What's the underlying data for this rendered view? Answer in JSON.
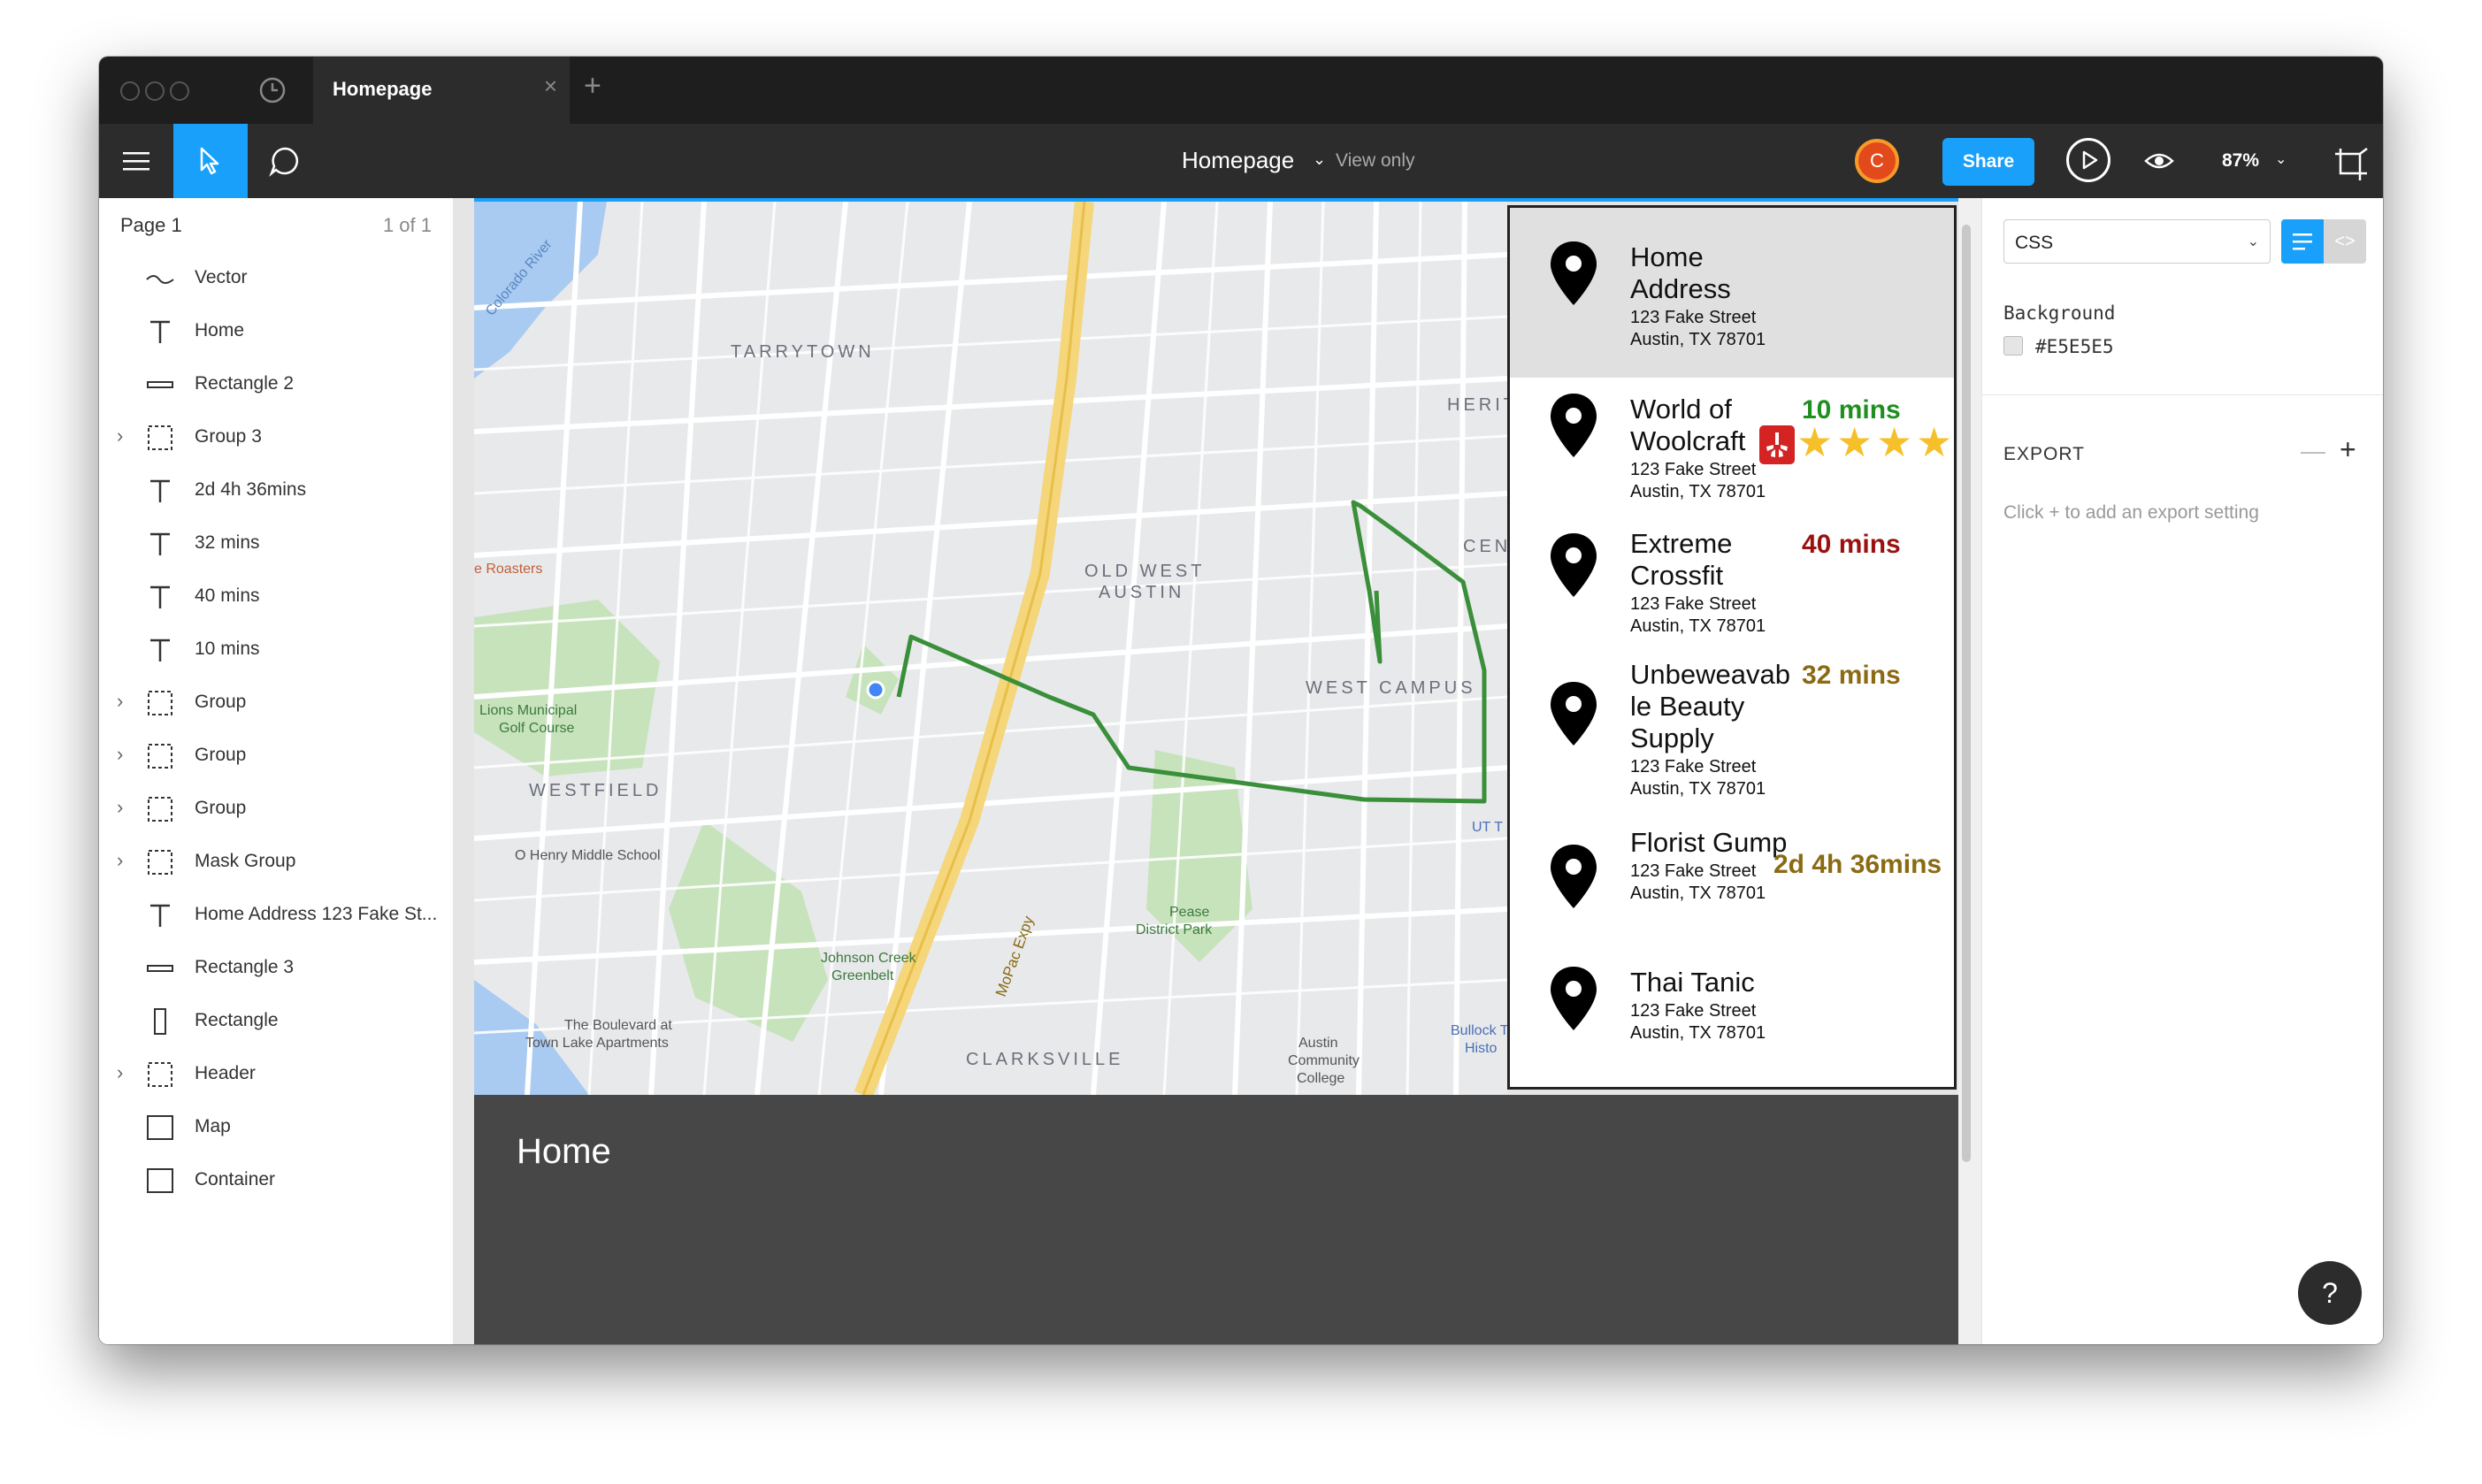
{
  "titlebar": {
    "tab_label": "Homepage",
    "tab_close": "×",
    "tab_add": "+"
  },
  "toolbar": {
    "doc_title": "Homepage",
    "doc_chevron": "⌄",
    "view_only": "View only",
    "avatar_initial": "C",
    "share_label": "Share",
    "zoom": "87%",
    "zoom_chevron": "⌄",
    "icons": [
      "menu-icon",
      "move-tool-icon",
      "comment-icon",
      "play-icon",
      "eye-icon",
      "crop-icon"
    ]
  },
  "left_panel": {
    "page_label": "Page 1",
    "page_count": "1 of 1",
    "layers": [
      {
        "label": "Vector",
        "icon": "vector",
        "caret": false
      },
      {
        "label": "Home",
        "icon": "text",
        "caret": false
      },
      {
        "label": "Rectangle 2",
        "icon": "rect-line",
        "caret": false
      },
      {
        "label": "Group 3",
        "icon": "group",
        "caret": true
      },
      {
        "label": "2d 4h 36mins",
        "icon": "text",
        "caret": false
      },
      {
        "label": "32 mins",
        "icon": "text",
        "caret": false
      },
      {
        "label": "40 mins",
        "icon": "text",
        "caret": false
      },
      {
        "label": "10 mins",
        "icon": "text",
        "caret": false
      },
      {
        "label": "Group",
        "icon": "group",
        "caret": true
      },
      {
        "label": "Group",
        "icon": "group",
        "caret": true
      },
      {
        "label": "Group",
        "icon": "group",
        "caret": true
      },
      {
        "label": "Mask Group",
        "icon": "group",
        "caret": true
      },
      {
        "label": "Home Address 123 Fake St...",
        "icon": "text",
        "caret": false
      },
      {
        "label": "Rectangle 3",
        "icon": "rect-line",
        "caret": false
      },
      {
        "label": "Rectangle",
        "icon": "rect-tall",
        "caret": false
      },
      {
        "label": "Header",
        "icon": "group",
        "caret": true
      },
      {
        "label": "Map",
        "icon": "frame",
        "caret": false
      },
      {
        "label": "Container",
        "icon": "frame",
        "caret": false
      }
    ]
  },
  "map": {
    "labels": [
      "TARRYTOWN",
      "OLD WEST",
      "AUSTIN",
      "WEST CAMPUS",
      "WESTFIELD",
      "CLARKSVILLE",
      "HERIT",
      "CEN",
      "Lions Municipal",
      "Golf Course",
      "O Henry Middle School",
      "Johnson Creek",
      "Greenbelt",
      "The Boulevard at",
      "Town Lake Apartments",
      "Pease",
      "District Park",
      "Austin",
      "Community",
      "College",
      "Bullock T",
      "Histo",
      "e Roasters",
      "Colorado River",
      "MoPac Expy",
      "UT T"
    ],
    "route_color": "#3a8f3a"
  },
  "list": {
    "items": [
      {
        "name_lines": [
          "Home",
          "Address"
        ],
        "street": "123 Fake Street",
        "city": "Austin, TX 78701",
        "time": "",
        "time_color": ""
      },
      {
        "name_lines": [
          "World of",
          "Woolcraft"
        ],
        "street": "123 Fake Street",
        "city": "Austin, TX 78701",
        "time": "10 mins",
        "time_color": "#1f8f1f",
        "rating_stars": 4,
        "badge": "yelp-icon"
      },
      {
        "name_lines": [
          "Extreme",
          "Crossfit"
        ],
        "street": "123 Fake Street",
        "city": "Austin, TX 78701",
        "time": "40 mins",
        "time_color": "#9b1111"
      },
      {
        "name_lines": [
          "Unbeweavab",
          "le Beauty",
          "Supply"
        ],
        "street": "123 Fake Street",
        "city": "Austin, TX 78701",
        "time": "32 mins",
        "time_color": "#8a6a12"
      },
      {
        "name_lines": [
          "Florist Gump"
        ],
        "street": "123 Fake Street",
        "city": "Austin, TX 78701",
        "time": "2d 4h 36mins",
        "time_color": "#8a6a12"
      },
      {
        "name_lines": [
          "Thai Tanic"
        ],
        "street": "123 Fake Street",
        "city": "Austin, TX 78701",
        "time": "",
        "time_color": ""
      }
    ]
  },
  "home_bar": {
    "title": "Home"
  },
  "right_panel": {
    "code_select": "CSS",
    "background_label": "Background",
    "background_value": "#E5E5E5",
    "export_label": "EXPORT",
    "export_minus": "—",
    "export_plus": "+",
    "export_hint": "Click + to add an export setting",
    "code_toggle": "<>"
  },
  "help": "?",
  "colors": {
    "accent": "#18a0fb",
    "toolbar": "#2c2c2c",
    "titlebar": "#1e1e1e",
    "canvas": "#e5e5e5",
    "home_bar": "#474747",
    "avatar": "#e24a1b"
  }
}
